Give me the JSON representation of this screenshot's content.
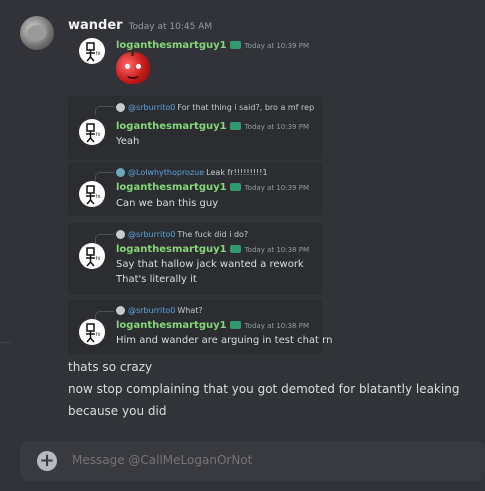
{
  "message": {
    "author": "wander",
    "timestamp": "Today at 10:45 AM"
  },
  "embeds": [
    {
      "author": "loganthesmartguy1",
      "timestamp": "Today at 10:39 PM"
    },
    {
      "reply_to": "@srburrito0",
      "reply_text": "For that thing i said?, bro a mf rep",
      "author": "loganthesmartguy1",
      "timestamp": "Today at 10:39 PM",
      "lines": [
        "Yeah"
      ]
    },
    {
      "reply_to": "@Lolwhythoprozue",
      "reply_text": "Leak fr!!!!!!!!!1",
      "author": "loganthesmartguy1",
      "timestamp": "Today at 10:39 PM",
      "lines": [
        "Can we ban this guy"
      ]
    },
    {
      "reply_to": "@srburrito0",
      "reply_text": "The fuck did i do?",
      "author": "loganthesmartguy1",
      "timestamp": "Today at 10:38 PM",
      "lines": [
        "Say that hallow jack wanted a rework",
        "That's literally it"
      ]
    },
    {
      "reply_to": "@srburrito0",
      "reply_text": "What?",
      "author": "loganthesmartguy1",
      "timestamp": "Today at 10:38 PM",
      "lines": [
        "Him and wander are arguing in test chat rn"
      ]
    }
  ],
  "body_lines": [
    "thats so crazy",
    "now stop complaining that you got demoted for blatantly leaking",
    "because you did"
  ],
  "composer": {
    "placeholder": "Message @CallMeLoganOrNot",
    "plus_glyph": "+"
  },
  "colors": {
    "background": "#313338",
    "embed_bg": "#2b2d31",
    "username_green": "#86d67a",
    "mention_blue": "#5aa4e0"
  }
}
